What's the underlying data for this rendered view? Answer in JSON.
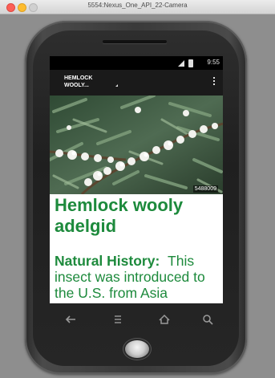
{
  "window": {
    "title": "5554:Nexus_One_API_22-Camera"
  },
  "status_bar": {
    "time": "9:55",
    "icons": [
      "signal-icon",
      "battery-icon"
    ]
  },
  "action_bar": {
    "spinner_label": "HEMLOCK WOOLY...",
    "overflow_icon": "overflow-menu-icon"
  },
  "content": {
    "photo_id": "5488009",
    "title": "Hemlock wooly adelgid",
    "section_label": "Natural History:",
    "section_text": "This insect was introduced to the U.S. from Asia"
  },
  "soft_keys": [
    "back-icon",
    "menu-icon",
    "home-icon",
    "search-icon"
  ],
  "colors": {
    "accent_green": "#1d8a3c",
    "action_bar": "#1a1a1a"
  }
}
